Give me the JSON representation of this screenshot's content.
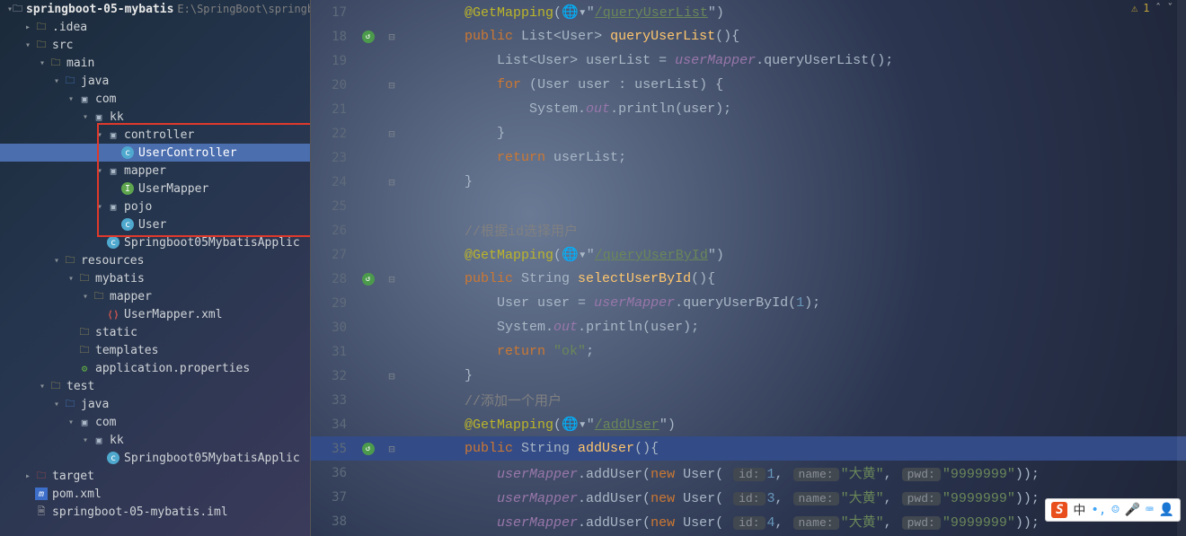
{
  "project": {
    "name": "springboot-05-mybatis",
    "path": "E:\\SpringBoot\\springbo"
  },
  "tree": [
    {
      "indent": 0,
      "arrow": "▾",
      "icon": "proj",
      "label": "springboot-05-mybatis",
      "suffix": "E:\\SpringBoot\\springbo"
    },
    {
      "indent": 1,
      "arrow": "▸",
      "icon": "folder",
      "label": ".idea"
    },
    {
      "indent": 1,
      "arrow": "▾",
      "icon": "folder",
      "label": "src"
    },
    {
      "indent": 2,
      "arrow": "▾",
      "icon": "folder",
      "label": "main"
    },
    {
      "indent": 3,
      "arrow": "▾",
      "icon": "srcroot",
      "label": "java"
    },
    {
      "indent": 4,
      "arrow": "▾",
      "icon": "pkg",
      "label": "com"
    },
    {
      "indent": 5,
      "arrow": "▾",
      "icon": "pkg",
      "label": "kk"
    },
    {
      "indent": 6,
      "arrow": "▾",
      "icon": "pkg",
      "label": "controller"
    },
    {
      "indent": 7,
      "arrow": "",
      "icon": "class",
      "label": "UserController",
      "selected": true
    },
    {
      "indent": 6,
      "arrow": "▾",
      "icon": "pkg",
      "label": "mapper"
    },
    {
      "indent": 7,
      "arrow": "",
      "icon": "iface",
      "label": "UserMapper"
    },
    {
      "indent": 6,
      "arrow": "▾",
      "icon": "pkg",
      "label": "pojo"
    },
    {
      "indent": 7,
      "arrow": "",
      "icon": "class",
      "label": "User"
    },
    {
      "indent": 6,
      "arrow": "",
      "icon": "class",
      "label": "Springboot05MybatisApplic"
    },
    {
      "indent": 3,
      "arrow": "▾",
      "icon": "resroot",
      "label": "resources"
    },
    {
      "indent": 4,
      "arrow": "▾",
      "icon": "folder",
      "label": "mybatis"
    },
    {
      "indent": 5,
      "arrow": "▾",
      "icon": "folder",
      "label": "mapper"
    },
    {
      "indent": 6,
      "arrow": "",
      "icon": "xml",
      "label": "UserMapper.xml"
    },
    {
      "indent": 4,
      "arrow": "",
      "icon": "folder",
      "label": "static"
    },
    {
      "indent": 4,
      "arrow": "",
      "icon": "folder",
      "label": "templates"
    },
    {
      "indent": 4,
      "arrow": "",
      "icon": "props",
      "label": "application.properties"
    },
    {
      "indent": 2,
      "arrow": "▾",
      "icon": "folder",
      "label": "test"
    },
    {
      "indent": 3,
      "arrow": "▾",
      "icon": "srcroot",
      "label": "java"
    },
    {
      "indent": 4,
      "arrow": "▾",
      "icon": "pkg",
      "label": "com"
    },
    {
      "indent": 5,
      "arrow": "▾",
      "icon": "pkg",
      "label": "kk"
    },
    {
      "indent": 6,
      "arrow": "",
      "icon": "class",
      "label": "Springboot05MybatisApplic"
    },
    {
      "indent": 1,
      "arrow": "▸",
      "icon": "excl",
      "label": "target"
    },
    {
      "indent": 1,
      "arrow": "",
      "icon": "maven",
      "label": "pom.xml"
    },
    {
      "indent": 1,
      "arrow": "",
      "icon": "file",
      "label": "springboot-05-mybatis.iml"
    }
  ],
  "inspection": {
    "warnings": "1"
  },
  "code": [
    {
      "n": 17,
      "fold": "",
      "mark": false,
      "segs": [
        [
          "        ",
          "op"
        ],
        [
          "@GetMapping",
          "ann"
        ],
        [
          "(",
          "op"
        ],
        [
          "🌐▾",
          "op"
        ],
        [
          "\"",
          "op"
        ],
        [
          "/queryUserList",
          "urlstr"
        ],
        [
          "\"",
          "op"
        ],
        [
          ")",
          "op"
        ]
      ]
    },
    {
      "n": 18,
      "fold": "⊟",
      "mark": true,
      "segs": [
        [
          "        ",
          "op"
        ],
        [
          "public ",
          "kw"
        ],
        [
          "List",
          "type"
        ],
        [
          "<",
          "op"
        ],
        [
          "User",
          "type"
        ],
        [
          "> ",
          "op"
        ],
        [
          "queryUserList",
          "fn"
        ],
        [
          "()",
          "op"
        ],
        [
          "{",
          "op"
        ]
      ]
    },
    {
      "n": 19,
      "fold": "",
      "mark": false,
      "segs": [
        [
          "            ",
          "op"
        ],
        [
          "List",
          "type"
        ],
        [
          "<",
          "op"
        ],
        [
          "User",
          "type"
        ],
        [
          "> ",
          "op"
        ],
        [
          "userList",
          "op"
        ],
        [
          " = ",
          "op"
        ],
        [
          "userMapper",
          "fld"
        ],
        [
          ".",
          "op"
        ],
        [
          "queryUserList",
          "op"
        ],
        [
          "();",
          "op"
        ]
      ]
    },
    {
      "n": 20,
      "fold": "⊟",
      "mark": false,
      "segs": [
        [
          "            ",
          "op"
        ],
        [
          "for ",
          "kw"
        ],
        [
          "(",
          "op"
        ],
        [
          "User ",
          "type"
        ],
        [
          "user : userList) {",
          "op"
        ]
      ]
    },
    {
      "n": 21,
      "fold": "",
      "mark": false,
      "segs": [
        [
          "                ",
          "op"
        ],
        [
          "System.",
          "type"
        ],
        [
          "out",
          "sfld"
        ],
        [
          ".println(user)",
          "op"
        ],
        [
          ";",
          "op"
        ]
      ]
    },
    {
      "n": 22,
      "fold": "⊟",
      "mark": false,
      "segs": [
        [
          "            }",
          "op"
        ]
      ]
    },
    {
      "n": 23,
      "fold": "",
      "mark": false,
      "segs": [
        [
          "            ",
          "op"
        ],
        [
          "return ",
          "kw"
        ],
        [
          "userList",
          "op"
        ],
        [
          ";",
          "op"
        ]
      ]
    },
    {
      "n": 24,
      "fold": "⊟",
      "mark": false,
      "segs": [
        [
          "        }",
          "op"
        ]
      ]
    },
    {
      "n": 25,
      "fold": "",
      "mark": false,
      "segs": [
        [
          "",
          ""
        ]
      ]
    },
    {
      "n": 26,
      "fold": "",
      "mark": false,
      "segs": [
        [
          "        ",
          "op"
        ],
        [
          "//根据id选择用户",
          "cmt"
        ]
      ]
    },
    {
      "n": 27,
      "fold": "",
      "mark": false,
      "segs": [
        [
          "        ",
          "op"
        ],
        [
          "@GetMapping",
          "ann"
        ],
        [
          "(",
          "op"
        ],
        [
          "🌐▾",
          "op"
        ],
        [
          "\"",
          "op"
        ],
        [
          "/queryUserById",
          "urlstr"
        ],
        [
          "\"",
          "op"
        ],
        [
          ")",
          "op"
        ]
      ]
    },
    {
      "n": 28,
      "fold": "⊟",
      "mark": true,
      "segs": [
        [
          "        ",
          "op"
        ],
        [
          "public ",
          "kw"
        ],
        [
          "String ",
          "type"
        ],
        [
          "selectUserById",
          "fn"
        ],
        [
          "()",
          "op"
        ],
        [
          "{",
          "op"
        ]
      ]
    },
    {
      "n": 29,
      "fold": "",
      "mark": false,
      "segs": [
        [
          "            ",
          "op"
        ],
        [
          "User ",
          "type"
        ],
        [
          "user = ",
          "op"
        ],
        [
          "userMapper",
          "fld"
        ],
        [
          ".queryUserById(",
          "op"
        ],
        [
          "1",
          "num"
        ],
        [
          ")",
          "op"
        ],
        [
          ";",
          "op"
        ]
      ]
    },
    {
      "n": 30,
      "fold": "",
      "mark": false,
      "segs": [
        [
          "            ",
          "op"
        ],
        [
          "System.",
          "type"
        ],
        [
          "out",
          "sfld"
        ],
        [
          ".println(user)",
          "op"
        ],
        [
          ";",
          "op"
        ]
      ]
    },
    {
      "n": 31,
      "fold": "",
      "mark": false,
      "segs": [
        [
          "            ",
          "op"
        ],
        [
          "return ",
          "kw"
        ],
        [
          "\"ok\"",
          "str"
        ],
        [
          ";",
          "op"
        ]
      ]
    },
    {
      "n": 32,
      "fold": "⊟",
      "mark": false,
      "segs": [
        [
          "        }",
          "op"
        ]
      ]
    },
    {
      "n": 33,
      "fold": "",
      "mark": false,
      "segs": [
        [
          "        ",
          "op"
        ],
        [
          "//添加一个用户",
          "cmt"
        ]
      ]
    },
    {
      "n": 34,
      "fold": "",
      "mark": false,
      "segs": [
        [
          "        ",
          "op"
        ],
        [
          "@GetMapping",
          "ann"
        ],
        [
          "(",
          "op"
        ],
        [
          "🌐▾",
          "op"
        ],
        [
          "\"",
          "op"
        ],
        [
          "/addUser",
          "urlstr"
        ],
        [
          "\"",
          "op"
        ],
        [
          ")",
          "op"
        ]
      ]
    },
    {
      "n": 35,
      "fold": "⊟",
      "mark": true,
      "hl": true,
      "segs": [
        [
          "        ",
          "op"
        ],
        [
          "public ",
          "kw"
        ],
        [
          "String ",
          "type"
        ],
        [
          "addUser",
          "fn"
        ],
        [
          "()",
          "op"
        ],
        [
          "{",
          "op"
        ]
      ]
    },
    {
      "n": 36,
      "fold": "",
      "mark": false,
      "hints": true,
      "id": "1",
      "segs_pre": [
        [
          "            ",
          "op"
        ],
        [
          "userMapper",
          "fld"
        ],
        [
          ".addUser(",
          "op"
        ],
        [
          "new ",
          "kw"
        ],
        [
          "User",
          "type"
        ],
        [
          "( ",
          "op"
        ]
      ],
      "segs_post": [
        [
          "))",
          "op"
        ],
        [
          ";",
          "op"
        ]
      ],
      "name": "\"大黄\"",
      "pwd": "\"9999999\""
    },
    {
      "n": 37,
      "fold": "",
      "mark": false,
      "hints": true,
      "id": "3",
      "segs_pre": [
        [
          "            ",
          "op"
        ],
        [
          "userMapper",
          "fld"
        ],
        [
          ".addUser(",
          "op"
        ],
        [
          "new ",
          "kw"
        ],
        [
          "User",
          "type"
        ],
        [
          "( ",
          "op"
        ]
      ],
      "segs_post": [
        [
          "))",
          "op"
        ],
        [
          ";",
          "op"
        ]
      ],
      "name": "\"大黄\"",
      "pwd": "\"9999999\""
    },
    {
      "n": 38,
      "fold": "",
      "mark": false,
      "hints": true,
      "id": "4",
      "segs_pre": [
        [
          "            ",
          "op"
        ],
        [
          "userMapper",
          "fld"
        ],
        [
          ".addUser(",
          "op"
        ],
        [
          "new ",
          "kw"
        ],
        [
          "User",
          "type"
        ],
        [
          "( ",
          "op"
        ]
      ],
      "segs_post": [
        [
          "))",
          "op"
        ],
        [
          ";",
          "op"
        ]
      ],
      "name": "\"大黄\"",
      "pwd": "\"9999999\""
    }
  ],
  "ime": {
    "logo": "S",
    "text": "中",
    "icons": [
      "☺",
      "🎤",
      "⌨",
      "👤"
    ]
  },
  "hint_labels": {
    "id": "id:",
    "name": "name:",
    "pwd": "pwd:"
  }
}
